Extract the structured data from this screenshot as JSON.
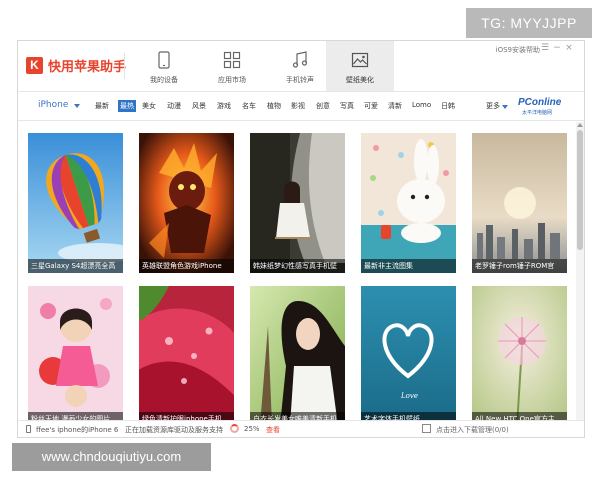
{
  "watermarks": {
    "tag": "TG: MYYJJPP",
    "site": "www.chndouqiutiyu.com"
  },
  "app": {
    "logo_letter": "K",
    "name": "快用苹果助手",
    "version": "iOS9安装帮助",
    "window_controls": [
      "☰",
      "−",
      "×"
    ]
  },
  "nav": [
    {
      "label": "我的设备",
      "icon": "phone-icon"
    },
    {
      "label": "应用市场",
      "icon": "apps-grid-icon"
    },
    {
      "label": "手机铃声",
      "icon": "music-note-icon"
    },
    {
      "label": "壁纸美化",
      "icon": "picture-icon",
      "active": true
    }
  ],
  "category_bar": {
    "device": "iPhone",
    "categories": [
      "最新",
      "最热",
      "美女",
      "动漫",
      "风景",
      "游戏",
      "名车",
      "植物",
      "影视",
      "创意",
      "写真",
      "可爱",
      "清新",
      "Lomo",
      "日韩"
    ],
    "active_index": 1,
    "more": "更多",
    "sponsor": "PConline",
    "sponsor_sub": "太平洋电脑网"
  },
  "wallpapers": [
    {
      "caption": "三星Galaxy S4超漂亮全高",
      "art": "balloon"
    },
    {
      "caption": "英雄联盟角色游戏iPhone",
      "art": "fire"
    },
    {
      "caption": "韩妹纸梦幻性感写真手机壁",
      "art": "swing"
    },
    {
      "caption": "最新非主流图集",
      "art": "bunny"
    },
    {
      "caption": "老罗锤子rom锤子ROM官",
      "art": "city"
    },
    {
      "caption": "粉丝天地 漫画少女的图片",
      "art": "cartoon"
    },
    {
      "caption": "绿色清新护眼iphone手机",
      "art": "leaf"
    },
    {
      "caption": "白衣长发美女唯美清新手机",
      "art": "girl"
    },
    {
      "caption": "艺术字体手机壁纸",
      "art": "heart"
    },
    {
      "caption": "All New HTC One官方主",
      "art": "dandelion"
    }
  ],
  "status": {
    "device": "ffee's iphone的iPhone 6",
    "loading": "正在加载资源库驱动及服务支持",
    "percent": "25%",
    "view": "查看",
    "downloads": "点击进入下载管理(0/0)"
  },
  "colors": {
    "brand": "#e8432c",
    "accent": "#2f74c7"
  }
}
